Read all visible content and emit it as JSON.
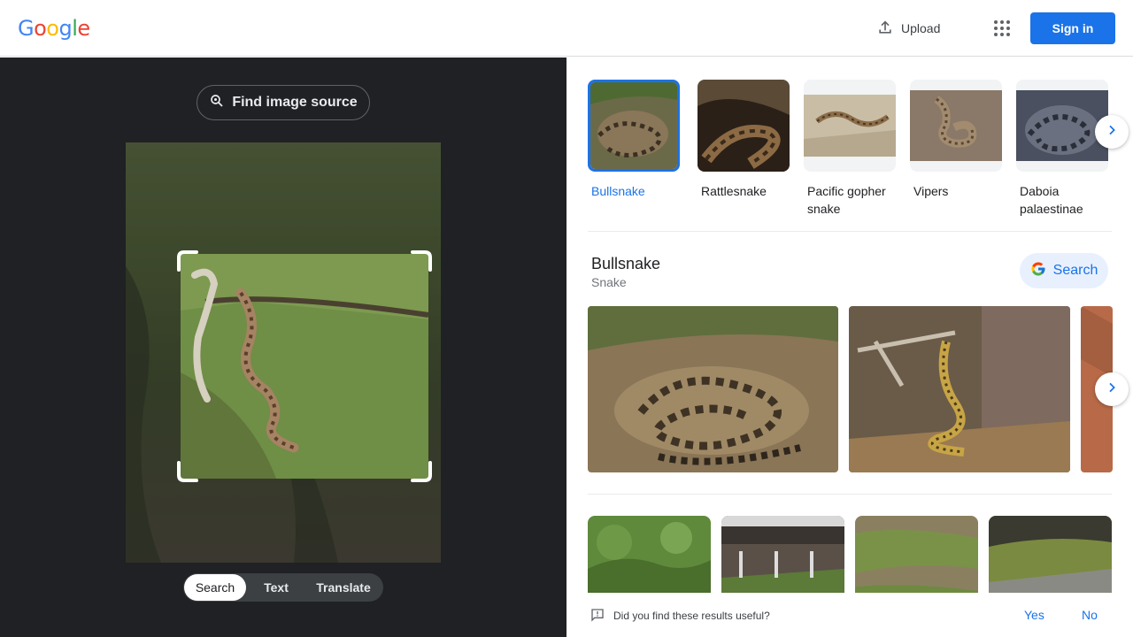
{
  "header": {
    "logo": "Google",
    "upload_label": "Upload",
    "apps_icon": "apps-grid-icon",
    "signin_label": "Sign in"
  },
  "left_panel": {
    "find_source_label": "Find image source",
    "modes": [
      {
        "label": "Search",
        "active": true
      },
      {
        "label": "Text",
        "active": false
      },
      {
        "label": "Translate",
        "active": false
      }
    ]
  },
  "related": {
    "items": [
      {
        "label": "Bullsnake",
        "selected": true
      },
      {
        "label": "Rattlesnake",
        "selected": false
      },
      {
        "label": "Pacific gopher snake",
        "selected": false
      },
      {
        "label": "Vipers",
        "selected": false
      },
      {
        "label": "Daboia palaestinae",
        "selected": false
      }
    ]
  },
  "entity": {
    "title": "Bullsnake",
    "subtitle": "Snake",
    "search_label": "Search"
  },
  "feedback": {
    "question": "Did you find these results useful?",
    "yes": "Yes",
    "no": "No"
  },
  "colors": {
    "accent": "#1a73e8",
    "dark_panel": "#202124"
  }
}
